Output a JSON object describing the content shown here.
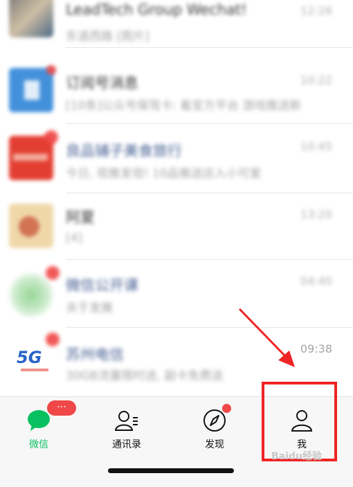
{
  "chats": [
    {
      "name": "LeadTech Group Wechat!",
      "preview": "东道西路 [图片]",
      "time": "12:26"
    },
    {
      "name": "订阅号消息",
      "preview": "[10条]公众号保驾卡: 着宣方平台 游戏推送新",
      "time": "10:22"
    },
    {
      "name": "良品铺子美食旅行",
      "preview": "今日, 现推发现! 10品推送店入小可爱",
      "time": "10:45"
    },
    {
      "name": "阿夏",
      "preview": "[4]",
      "time": "13:20"
    },
    {
      "name": "微信公开课",
      "preview": "关于发展",
      "time": "04:40"
    },
    {
      "name": "苏州电信",
      "preview": "30GB流量限时送, 副卡免费送",
      "time": "09:38"
    }
  ],
  "tabs": {
    "chat": "微信",
    "contacts": "通讯录",
    "discover": "发现",
    "me": "我"
  },
  "badges": {
    "chat_more": "···"
  },
  "watermark": "Baidu经验"
}
